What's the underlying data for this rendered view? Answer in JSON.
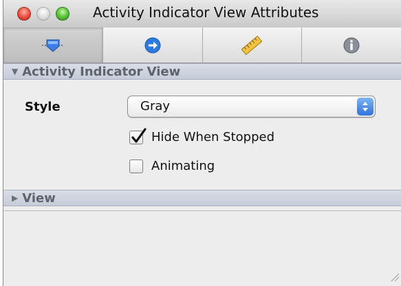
{
  "window": {
    "title": "Activity Indicator View Attributes"
  },
  "toolbar": {
    "tabs": [
      {
        "icon": "attributes-slider-icon",
        "selected": true
      },
      {
        "icon": "connections-arrow-icon",
        "selected": false
      },
      {
        "icon": "size-ruler-icon",
        "selected": false
      },
      {
        "icon": "identity-info-icon",
        "selected": false
      }
    ]
  },
  "section_activity": {
    "label": "Activity Indicator View",
    "expanded": true
  },
  "style_field": {
    "label": "Style",
    "value": "Gray"
  },
  "options": {
    "hide_when_stopped": {
      "label": "Hide When Stopped",
      "checked": true
    },
    "animating": {
      "label": "Animating",
      "checked": false
    }
  },
  "section_view": {
    "label": "View",
    "expanded": false
  },
  "colors": {
    "accent_blue": "#2f72d9",
    "section_header": "#cfd4de"
  }
}
